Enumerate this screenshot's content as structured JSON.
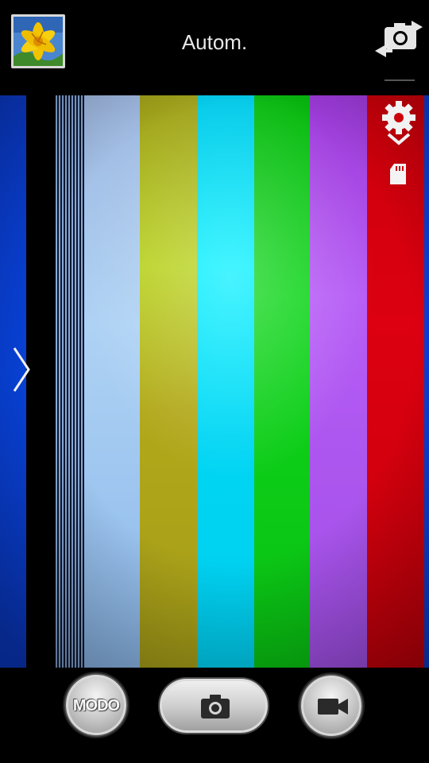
{
  "header": {
    "scene_mode_label": "Autom.",
    "gallery_thumbnail_icon": "yellow-lily-photo",
    "switch_camera_icon": "switch-camera-icon"
  },
  "viewfinder": {
    "description_icons": [
      "settings-gear-icon",
      "chevron-down-icon",
      "sd-card-icon",
      "chevron-right-icon"
    ],
    "color_bars": [
      "#0a3fd6",
      "#000000",
      "#9cc6ee",
      "#b0b21c",
      "#00e0f6",
      "#0dcc16",
      "#a64df0",
      "#d8000c",
      "#0a3fd6"
    ]
  },
  "controls": {
    "mode_button_label": "MODO",
    "shutter_icon": "camera-icon",
    "video_icon": "video-camera-icon"
  }
}
